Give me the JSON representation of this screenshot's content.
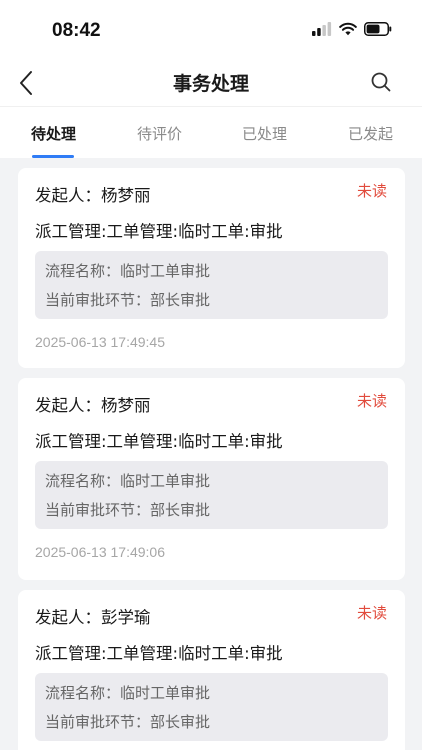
{
  "status_bar": {
    "time": "08:42",
    "battery_level": 0.65,
    "signal_bars": 2
  },
  "nav": {
    "title": "事务处理",
    "back_icon": "chevron-left-icon",
    "search_icon": "search-icon"
  },
  "tabs": [
    {
      "label": "待处理",
      "active": true
    },
    {
      "label": "待评价",
      "active": false
    },
    {
      "label": "已处理",
      "active": false
    },
    {
      "label": "已发起",
      "active": false
    }
  ],
  "cards": [
    {
      "initiator": "发起人：杨梦丽",
      "status": "未读",
      "path": "派工管理:工单管理:临时工单:审批",
      "process_name": "流程名称：临时工单审批",
      "current_step": "当前审批环节：部长审批",
      "time": "2025-06-13 17:49:45"
    },
    {
      "initiator": "发起人：杨梦丽",
      "status": "未读",
      "path": "派工管理:工单管理:临时工单:审批",
      "process_name": "流程名称：临时工单审批",
      "current_step": "当前审批环节：部长审批",
      "time": "2025-06-13 17:49:06"
    },
    {
      "initiator": "发起人：彭学瑜",
      "status": "未读",
      "path": "派工管理:工单管理:临时工单:审批",
      "process_name": "流程名称：临时工单审批",
      "current_step": "当前审批环节：部长审批",
      "time": ""
    }
  ],
  "colors": {
    "accent": "#2f7cf6",
    "unread": "#e14b3c",
    "background": "#f2f3f5"
  }
}
